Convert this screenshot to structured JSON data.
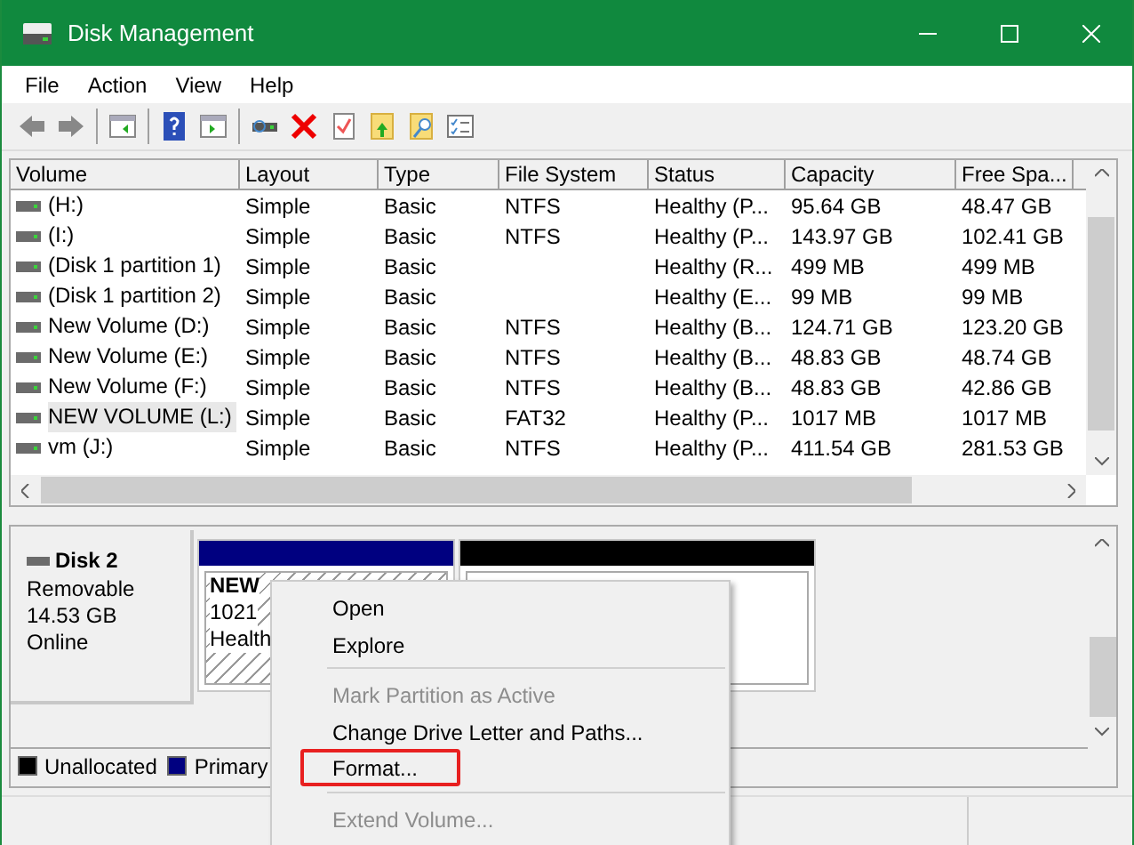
{
  "window": {
    "title": "Disk Management"
  },
  "menu": [
    "File",
    "Action",
    "View",
    "Help"
  ],
  "table": {
    "columns": [
      "Volume",
      "Layout",
      "Type",
      "File System",
      "Status",
      "Capacity",
      "Free Spa..."
    ],
    "rows": [
      {
        "selected": false,
        "cells": [
          "(H:)",
          "Simple",
          "Basic",
          "NTFS",
          "Healthy (P...",
          "95.64 GB",
          "48.47 GB"
        ]
      },
      {
        "selected": false,
        "cells": [
          "(I:)",
          "Simple",
          "Basic",
          "NTFS",
          "Healthy (P...",
          "143.97 GB",
          "102.41 GB"
        ]
      },
      {
        "selected": false,
        "cells": [
          "(Disk 1 partition 1)",
          "Simple",
          "Basic",
          "",
          "Healthy (R...",
          "499 MB",
          "499 MB"
        ]
      },
      {
        "selected": false,
        "cells": [
          "(Disk 1 partition 2)",
          "Simple",
          "Basic",
          "",
          "Healthy (E...",
          "99 MB",
          "99 MB"
        ]
      },
      {
        "selected": false,
        "cells": [
          "New Volume (D:)",
          "Simple",
          "Basic",
          "NTFS",
          "Healthy (B...",
          "124.71 GB",
          "123.20 GB"
        ]
      },
      {
        "selected": false,
        "cells": [
          "New Volume (E:)",
          "Simple",
          "Basic",
          "NTFS",
          "Healthy (B...",
          "48.83 GB",
          "48.74 GB"
        ]
      },
      {
        "selected": false,
        "cells": [
          "New Volume (F:)",
          "Simple",
          "Basic",
          "NTFS",
          "Healthy (B...",
          "48.83 GB",
          "42.86 GB"
        ]
      },
      {
        "selected": true,
        "cells": [
          "NEW VOLUME (L:)",
          "Simple",
          "Basic",
          "FAT32",
          "Healthy (P...",
          "1017 MB",
          "1017 MB"
        ]
      },
      {
        "selected": false,
        "cells": [
          "vm (J:)",
          "Simple",
          "Basic",
          "NTFS",
          "Healthy (P...",
          "411.54 GB",
          "281.53 GB"
        ]
      }
    ]
  },
  "disk": {
    "name": "Disk 2",
    "lines": [
      "Removable",
      "14.53 GB",
      "Online"
    ],
    "partitions": [
      {
        "kind": "primary",
        "lines": [
          "NEW",
          "1021",
          "Health"
        ]
      },
      {
        "kind": "unallocated"
      }
    ]
  },
  "legend": [
    {
      "label": "Unallocated",
      "color": "#000000"
    },
    {
      "label": "Primary",
      "color": "#000080"
    }
  ],
  "context_menu": [
    {
      "kind": "item",
      "label": "Open",
      "disabled": false,
      "highlighted": false
    },
    {
      "kind": "item",
      "label": "Explore",
      "disabled": false,
      "highlighted": false
    },
    {
      "kind": "separator"
    },
    {
      "kind": "item",
      "label": "Mark Partition as Active",
      "disabled": true,
      "highlighted": false
    },
    {
      "kind": "item",
      "label": "Change Drive Letter and Paths...",
      "disabled": false,
      "highlighted": false
    },
    {
      "kind": "item",
      "label": "Format...",
      "disabled": false,
      "highlighted": true
    },
    {
      "kind": "separator"
    },
    {
      "kind": "item",
      "label": "Extend Volume...",
      "disabled": true,
      "highlighted": false
    }
  ]
}
